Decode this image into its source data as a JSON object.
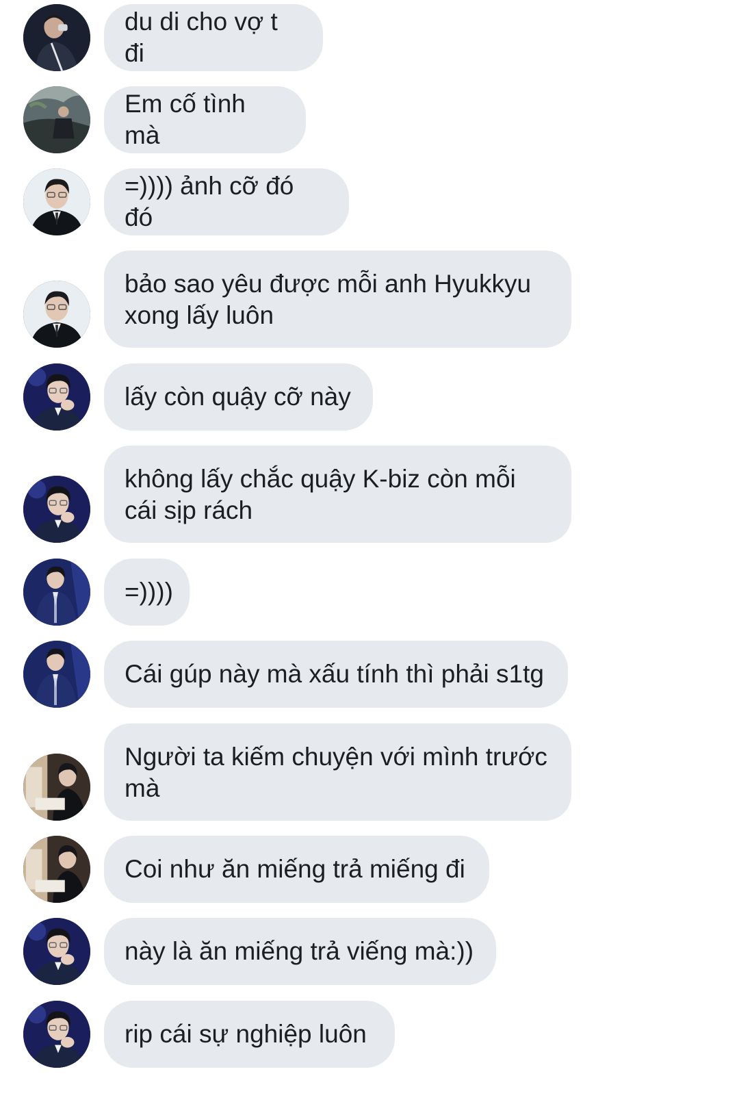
{
  "messages": [
    {
      "text": "du di cho vợ t đi",
      "avatar": "person-dark-suit-drinking"
    },
    {
      "text": "Em cố tình mà",
      "avatar": "person-sitting-outdoors"
    },
    {
      "text": "=)))) ảnh cỡ đó đó",
      "avatar": "person-glasses-black-suit"
    },
    {
      "text": "bảo sao yêu được mỗi anh Hyukkyu xong lấy luôn",
      "avatar": "person-glasses-black-suit"
    },
    {
      "text": "lấy còn quậy cỡ này",
      "avatar": "person-glasses-hand-chin"
    },
    {
      "text": "không lấy chắc quậy K-biz còn mỗi cái sịp rách",
      "avatar": "person-glasses-hand-chin"
    },
    {
      "text": "=))))",
      "avatar": "person-navy-suit-stage"
    },
    {
      "text": "Cái gúp này mà xấu tính thì phải s1tg",
      "avatar": "person-navy-suit-stage"
    },
    {
      "text": "Người ta kiếm chuyện với mình trước mà",
      "avatar": "person-indoor-room"
    },
    {
      "text": "Coi như ăn miếng trả miếng đi",
      "avatar": "person-indoor-room"
    },
    {
      "text": "này là ăn miếng trả viếng mà:))",
      "avatar": "person-glasses-hand-chin"
    },
    {
      "text": "rip cái sự nghiệp luôn",
      "avatar": "person-glasses-hand-chin"
    }
  ],
  "colors": {
    "bubble": "#e6eaee",
    "text": "#1c1e21",
    "background": "#ffffff"
  }
}
